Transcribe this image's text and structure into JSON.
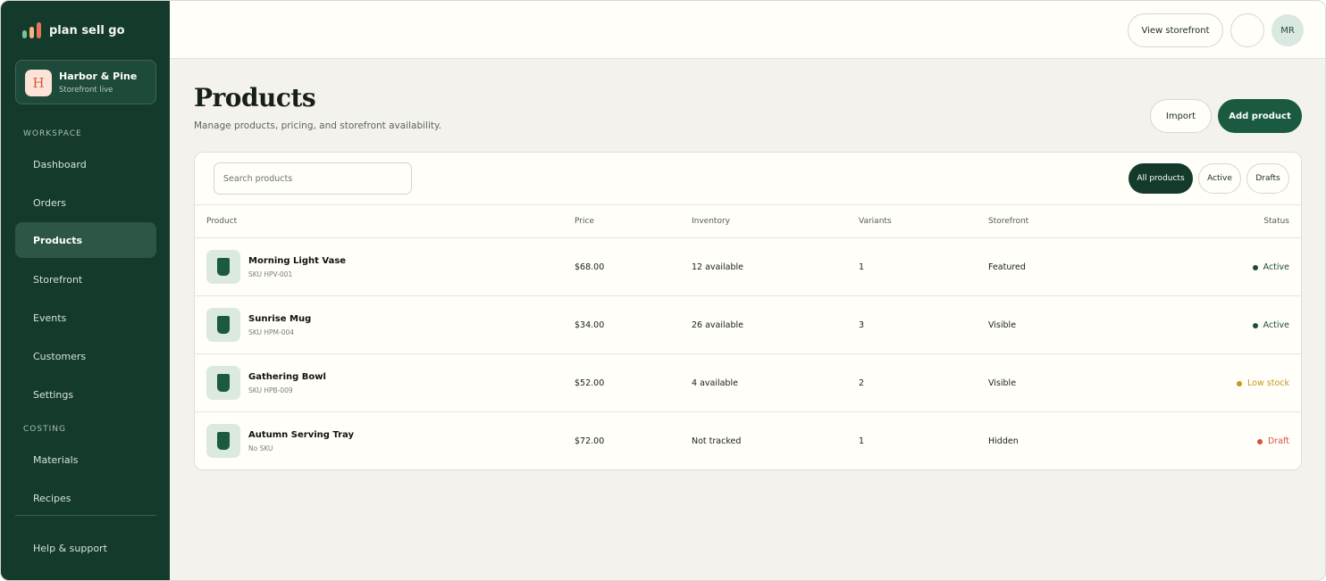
{
  "brand": {
    "name": "plan sell go",
    "bar_colors": [
      "#7fbf9a",
      "#f2b680",
      "#e7735a"
    ]
  },
  "store": {
    "initial": "H",
    "name": "Harbor & Pine",
    "status": "Storefront live"
  },
  "sidebar": {
    "workspace_label": "WORKSPACE",
    "workspace_items": [
      {
        "label": "Dashboard"
      },
      {
        "label": "Orders"
      },
      {
        "label": "Products",
        "active": true
      },
      {
        "label": "Storefront"
      },
      {
        "label": "Events"
      },
      {
        "label": "Customers"
      },
      {
        "label": "Settings"
      }
    ],
    "costing_label": "COSTING",
    "costing_items": [
      {
        "label": "Materials"
      },
      {
        "label": "Recipes"
      }
    ],
    "help_label": "Help & support"
  },
  "topbar": {
    "view_storefront": "View storefront",
    "user_initials": "MR"
  },
  "header": {
    "title": "Products",
    "subtitle": "Manage products, pricing, and storefront availability.",
    "import_label": "Import",
    "add_label": "Add product"
  },
  "search": {
    "placeholder": "Search products",
    "value": ""
  },
  "filters": [
    {
      "label": "All products",
      "active": true
    },
    {
      "label": "Active",
      "active": false
    },
    {
      "label": "Drafts",
      "active": false
    }
  ],
  "table": {
    "columns": [
      "Product",
      "Price",
      "Inventory",
      "Variants",
      "Storefront",
      "Status"
    ],
    "rows": [
      {
        "name": "Morning Light Vase",
        "sku": "SKU HPV-001",
        "price": "$68.00",
        "inventory": "12 available",
        "variants": "1",
        "storefront": "Featured",
        "status": "Active",
        "status_color": "#1c4c3a"
      },
      {
        "name": "Sunrise Mug",
        "sku": "SKU HPM-004",
        "price": "$34.00",
        "inventory": "26 available",
        "variants": "3",
        "storefront": "Visible",
        "status": "Active",
        "status_color": "#1c4c3a"
      },
      {
        "name": "Gathering Bowl",
        "sku": "SKU HPB-009",
        "price": "$52.00",
        "inventory": "4 available",
        "variants": "2",
        "storefront": "Visible",
        "status": "Low stock",
        "status_color": "#c9951b"
      },
      {
        "name": "Autumn Serving Tray",
        "sku": "No SKU",
        "price": "$72.00",
        "inventory": "Not tracked",
        "variants": "1",
        "storefront": "Hidden",
        "status": "Draft",
        "status_color": "#d9503f"
      }
    ]
  },
  "colors": {
    "sidebar_bg": "#143a2c",
    "accent": "#1a5a40",
    "page_bg": "#f4f2ec",
    "card_bg": "#fffef9"
  }
}
